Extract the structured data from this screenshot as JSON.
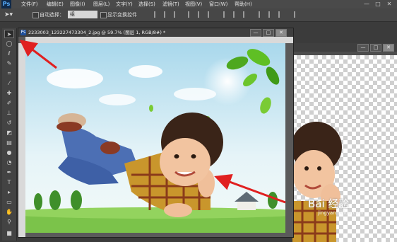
{
  "app": {
    "logo": "Ps",
    "menu": [
      "文件(F)",
      "编辑(E)",
      "图像(I)",
      "图层(L)",
      "文字(Y)",
      "选择(S)",
      "滤镜(T)",
      "视图(V)",
      "窗口(W)",
      "帮助(H)"
    ],
    "window_controls": [
      "—",
      "□",
      "✕"
    ]
  },
  "options": {
    "auto_select_label": "自动选择：",
    "auto_select_value": "组",
    "show_transform_label": "显示变换控件"
  },
  "document": {
    "title": "2233003_123227473304_2.jpg @ 59.7% (图层 1, RGB/8#) *",
    "controls": [
      "—",
      "□",
      "✕"
    ]
  },
  "document2": {
    "controls": [
      "—",
      "□",
      "✕"
    ]
  },
  "watermark": {
    "text": "Bai 经验",
    "url": "jingyan.baidu.com"
  },
  "colors": {
    "arrow": "#e02020",
    "sky": "#cfeaf7",
    "grass": "#7bc34a"
  }
}
